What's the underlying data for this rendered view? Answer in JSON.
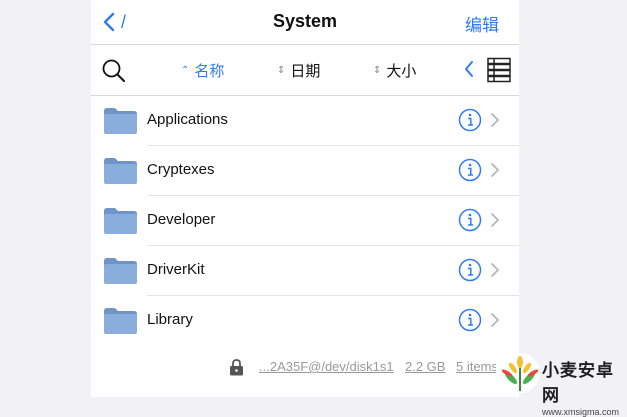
{
  "nav": {
    "back_path": "/",
    "title": "System",
    "edit_label": "编辑"
  },
  "toolbar": {
    "sort_options": [
      {
        "label": "名称",
        "active": true
      },
      {
        "label": "日期",
        "active": false
      },
      {
        "label": "大小",
        "active": false
      }
    ],
    "icons": [
      "search-icon",
      "chevron-left-icon",
      "list-view-icon"
    ]
  },
  "files": [
    {
      "name": "Applications",
      "type": "folder"
    },
    {
      "name": "Cryptexes",
      "type": "folder"
    },
    {
      "name": "Developer",
      "type": "folder"
    },
    {
      "name": "DriverKit",
      "type": "folder"
    },
    {
      "name": "Library",
      "type": "folder"
    }
  ],
  "footer": {
    "device": "...2A35F@/dev/disk1s1",
    "size": "2.2 GB",
    "count": "5 items"
  },
  "watermark": {
    "title": "小麦安卓网",
    "url": "www.xmsigma.com"
  },
  "colors": {
    "accent": "#2f7bf5",
    "folder": "#8aaedc",
    "folder_tab": "#6f95c8"
  }
}
